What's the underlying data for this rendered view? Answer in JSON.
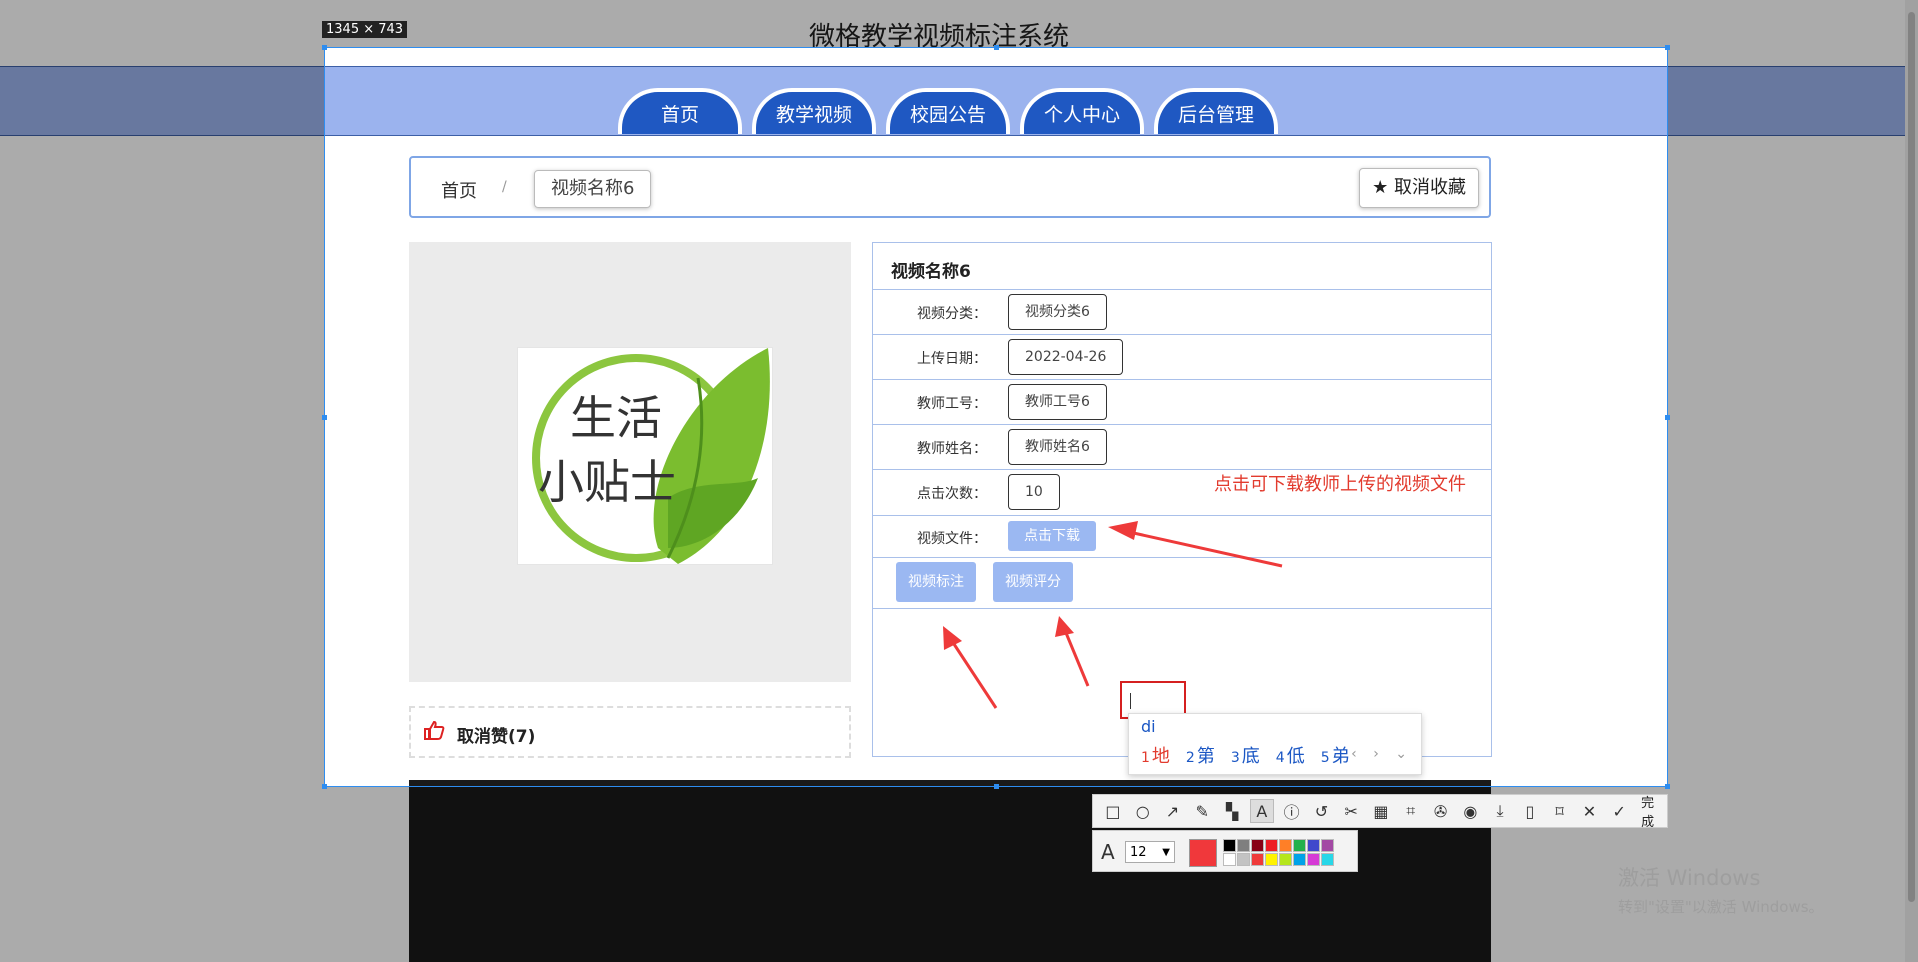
{
  "page": {
    "site_title": "微格教学视频标注系统",
    "nav": [
      "首页",
      "教学视频",
      "校园公告",
      "个人中心",
      "后台管理"
    ],
    "breadcrumb": {
      "home": "首页",
      "sep": "/",
      "current": "视频名称6"
    },
    "fav_button": "★ 取消收藏",
    "like_text": "取消赞(7)",
    "poster_text": [
      "生活",
      "小贴士"
    ],
    "info": {
      "title": "视频名称6",
      "rows": [
        {
          "label": "视频分类：",
          "value": "视频分类6"
        },
        {
          "label": "上传日期：",
          "value": "2022-04-26"
        },
        {
          "label": "教师工号：",
          "value": "教师工号6"
        },
        {
          "label": "教师姓名：",
          "value": "教师姓名6"
        },
        {
          "label": "点击次数：",
          "value": "10"
        }
      ],
      "file_label": "视频文件：",
      "download": "点击下载",
      "annotate": "视频标注",
      "rate": "视频评分"
    }
  },
  "screenshot_tool": {
    "selection_size": "1345 × 743",
    "annotation_note": "点击可下载教师上传的视频文件",
    "ime_input": "di",
    "ime_candidates": [
      {
        "num": "1",
        "text": "地"
      },
      {
        "num": "2",
        "text": "第"
      },
      {
        "num": "3",
        "text": "底"
      },
      {
        "num": "4",
        "text": "低"
      },
      {
        "num": "5",
        "text": "弟"
      }
    ],
    "ime_nav": "‹ › ⌄",
    "done_label": "完成",
    "font_size": "12",
    "current_color": "#f0383b",
    "swatches": [
      "#000000",
      "#7f7f7f",
      "#880015",
      "#ed1c24",
      "#ff7f27",
      "#22b14c",
      "#3f48cc",
      "#a349a4",
      "#ffffff",
      "#c3c3c3",
      "#ef3b3b",
      "#fff200",
      "#b5e61d",
      "#00a2e8",
      "#d63ad6",
      "#27d7e8"
    ]
  },
  "windows_activate": {
    "line1": "激活 Windows",
    "line2": "转到\"设置\"以激活 Windows。"
  }
}
